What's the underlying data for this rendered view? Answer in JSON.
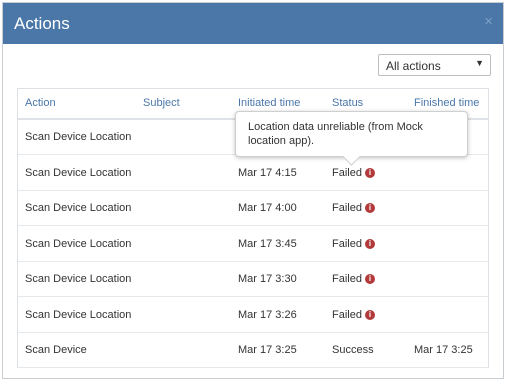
{
  "dialog": {
    "title": "Actions",
    "close_glyph": "×"
  },
  "filter": {
    "selected": "All actions",
    "caret": "▼"
  },
  "table": {
    "headers": {
      "action": "Action",
      "subject": "Subject",
      "initiated": "Initiated time",
      "status": "Status",
      "finished": "Finished time"
    },
    "rows": [
      {
        "action": "Scan Device Location",
        "subject": "",
        "initiated": "",
        "status": "",
        "finished": ""
      },
      {
        "action": "Scan Device Location",
        "subject": "",
        "initiated": "Mar 17 4:15",
        "status": "Failed",
        "finished": ""
      },
      {
        "action": "Scan Device Location",
        "subject": "",
        "initiated": "Mar 17 4:00",
        "status": "Failed",
        "finished": ""
      },
      {
        "action": "Scan Device Location",
        "subject": "",
        "initiated": "Mar 17 3:45",
        "status": "Failed",
        "finished": ""
      },
      {
        "action": "Scan Device Location",
        "subject": "",
        "initiated": "Mar 17 3:30",
        "status": "Failed",
        "finished": ""
      },
      {
        "action": "Scan Device Location",
        "subject": "",
        "initiated": "Mar 17 3:26",
        "status": "Failed",
        "finished": ""
      },
      {
        "action": "Scan Device",
        "subject": "",
        "initiated": "Mar 17 3:25",
        "status": "Success",
        "finished": "Mar 17 3:25"
      }
    ]
  },
  "tooltip": {
    "text": "Location data unreliable (from Mock location app)."
  },
  "icons": {
    "info": "info-icon",
    "info_glyph": "i"
  },
  "colors": {
    "header_bg": "#4a77a8",
    "link_blue": "#4a77a8",
    "failed_icon": "#b23a3a"
  }
}
